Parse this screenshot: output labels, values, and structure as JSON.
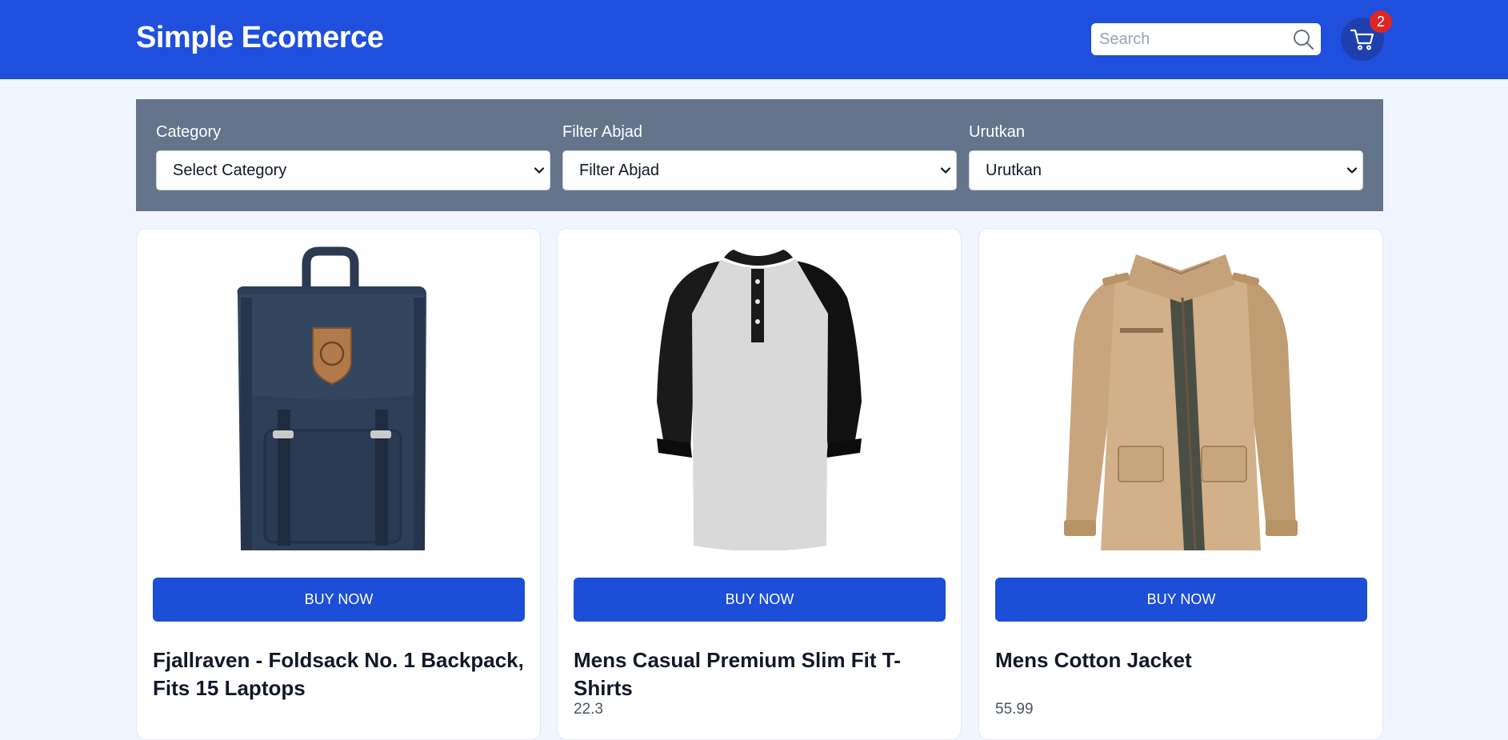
{
  "header": {
    "brand": "Simple Ecomerce",
    "search_placeholder": "Search",
    "cart_count": "2",
    "color": "#1f4fdc"
  },
  "filters": [
    {
      "label": "Category",
      "value": "Select Category"
    },
    {
      "label": "Filter Abjad",
      "value": "Filter Abjad"
    },
    {
      "label": "Urutkan",
      "value": "Urutkan"
    }
  ],
  "products": [
    {
      "title": "Fjallraven - Foldsack No. 1 Backpack, Fits 15 Laptops",
      "price": "",
      "button": "BUY NOW",
      "image": "navy-backpack"
    },
    {
      "title": "Mens Casual Premium Slim Fit T-Shirts",
      "price": "22.3",
      "button": "BUY NOW",
      "image": "raglan-tshirt"
    },
    {
      "title": "Mens Cotton Jacket",
      "price": "55.99",
      "button": "BUY NOW",
      "image": "khaki-jacket"
    }
  ]
}
